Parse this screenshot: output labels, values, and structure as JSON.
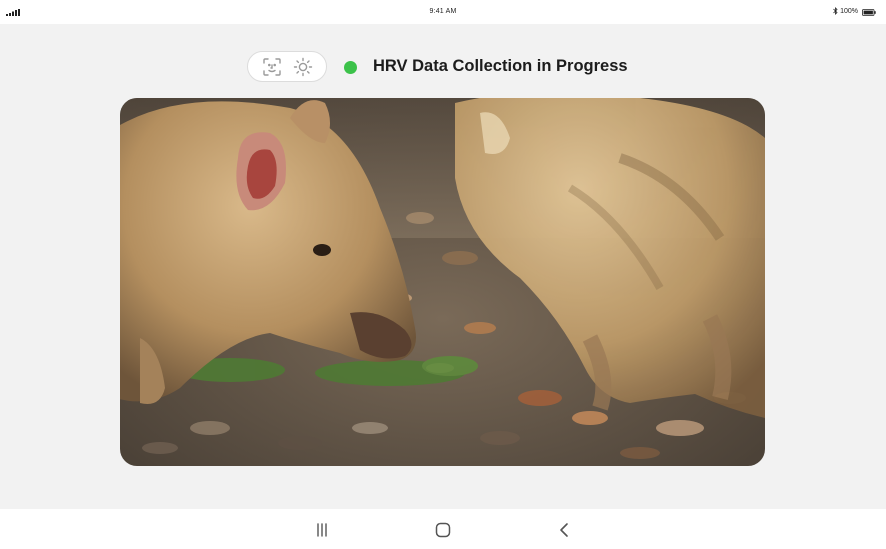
{
  "status_bar": {
    "time": "9:41 AM",
    "battery": "100%"
  },
  "toolbar": {
    "buttons": [
      {
        "icon": "face-scan-icon"
      },
      {
        "icon": "brightness-icon"
      }
    ]
  },
  "recording_status": {
    "label": "HRV Data Collection in Progress",
    "indicator_color": "#3cc24a"
  },
  "video": {
    "subject": "wild boar piglets foraging"
  },
  "nav_bar": {
    "buttons": [
      {
        "icon": "recent-apps-icon"
      },
      {
        "icon": "home-icon"
      },
      {
        "icon": "back-icon"
      }
    ]
  }
}
